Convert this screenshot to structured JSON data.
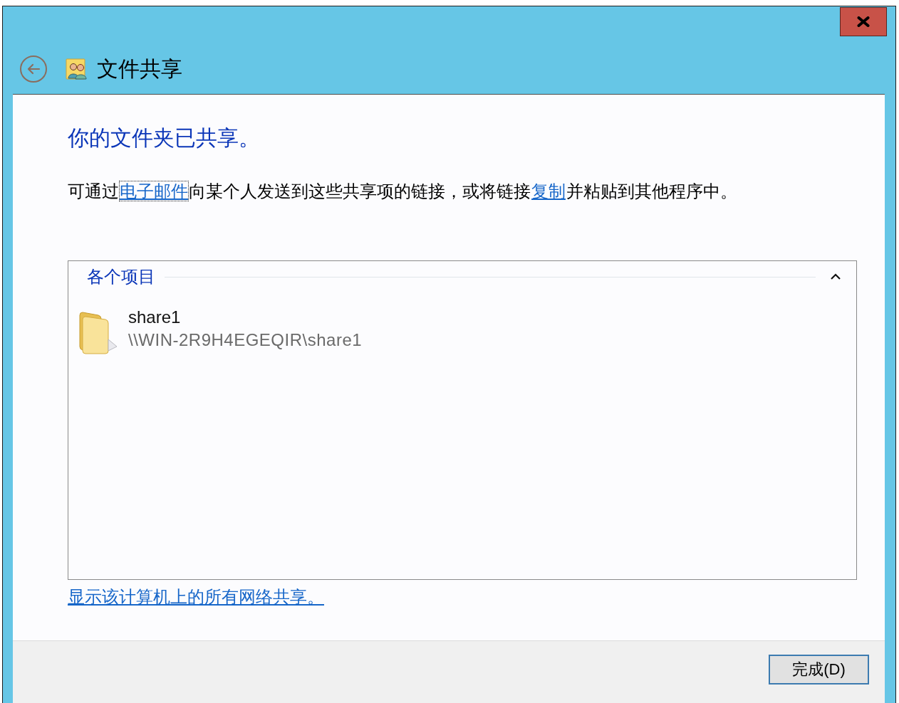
{
  "window": {
    "title": "文件共享"
  },
  "heading": "你的文件夹已共享。",
  "message": {
    "parts": [
      {
        "kind": "text",
        "text": "可通过"
      },
      {
        "kind": "link",
        "text": "电子邮件",
        "focused": true
      },
      {
        "kind": "text",
        "text": "向某个人发送到这些共享项的链接，或将链接"
      },
      {
        "kind": "link",
        "text": "复制",
        "focused": false
      },
      {
        "kind": "text",
        "text": "并粘贴到其他程序中。"
      }
    ]
  },
  "group": {
    "title": "各个项目",
    "expanded": true,
    "items": [
      {
        "name": "share1",
        "path": "\\\\WIN-2R9H4EGEQIR\\share1"
      }
    ]
  },
  "footer_link": "显示该计算机上的所有网络共享。",
  "buttons": [
    {
      "label": "完成(D)",
      "default": true
    }
  ]
}
